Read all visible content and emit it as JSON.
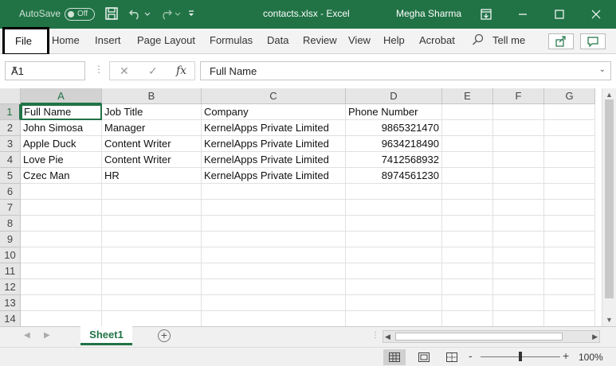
{
  "title_bar": {
    "autosave_label": "AutoSave",
    "autosave_state": "Off",
    "document_title": "contacts.xlsx  -  Excel",
    "user_name": "Megha Sharma",
    "icons": [
      "save-icon",
      "undo-icon",
      "redo-icon",
      "customize-qat-icon",
      "ribbon-display-icon",
      "minimize-icon",
      "maximize-icon",
      "close-icon"
    ]
  },
  "ribbon": {
    "tabs": [
      "File",
      "Home",
      "Insert",
      "Page Layout",
      "Formulas",
      "Data",
      "Review",
      "View",
      "Help",
      "Acrobat"
    ],
    "tell_me": "Tell me",
    "icons": [
      "share-icon",
      "comments-icon",
      "lightbulb-search-icon"
    ]
  },
  "formula_bar": {
    "name_box": "A1",
    "cancel_symbol": "✕",
    "enter_symbol": "✓",
    "fx_symbol": "fx",
    "content": "Full Name"
  },
  "sheet": {
    "columns": [
      "A",
      "B",
      "C",
      "D",
      "E",
      "F",
      "G"
    ],
    "row_numbers": [
      "1",
      "2",
      "3",
      "4",
      "5",
      "6",
      "7",
      "8",
      "9",
      "10",
      "11",
      "12",
      "13",
      "14"
    ],
    "active_cell": "A1",
    "rows": [
      [
        "Full Name",
        "Job Title",
        "Company",
        "Phone Number"
      ],
      [
        "John Simosa",
        "Manager",
        "KernelApps Private Limited",
        "9865321470"
      ],
      [
        "Apple Duck",
        "Content Writer",
        "KernelApps Private Limited",
        "9634218490"
      ],
      [
        "Love Pie",
        "Content Writer",
        "KernelApps Private Limited",
        "7412568932"
      ],
      [
        "Czec Man",
        "HR",
        "KernelApps Private Limited",
        "8974561230"
      ]
    ]
  },
  "sheet_tabs": {
    "tabs": [
      "Sheet1"
    ],
    "add_symbol": "+"
  },
  "status_bar": {
    "zoom": "100%",
    "zoom_minus": "-",
    "zoom_plus": "+"
  },
  "colors": {
    "accent": "#217346",
    "title_bar": "#217346"
  }
}
